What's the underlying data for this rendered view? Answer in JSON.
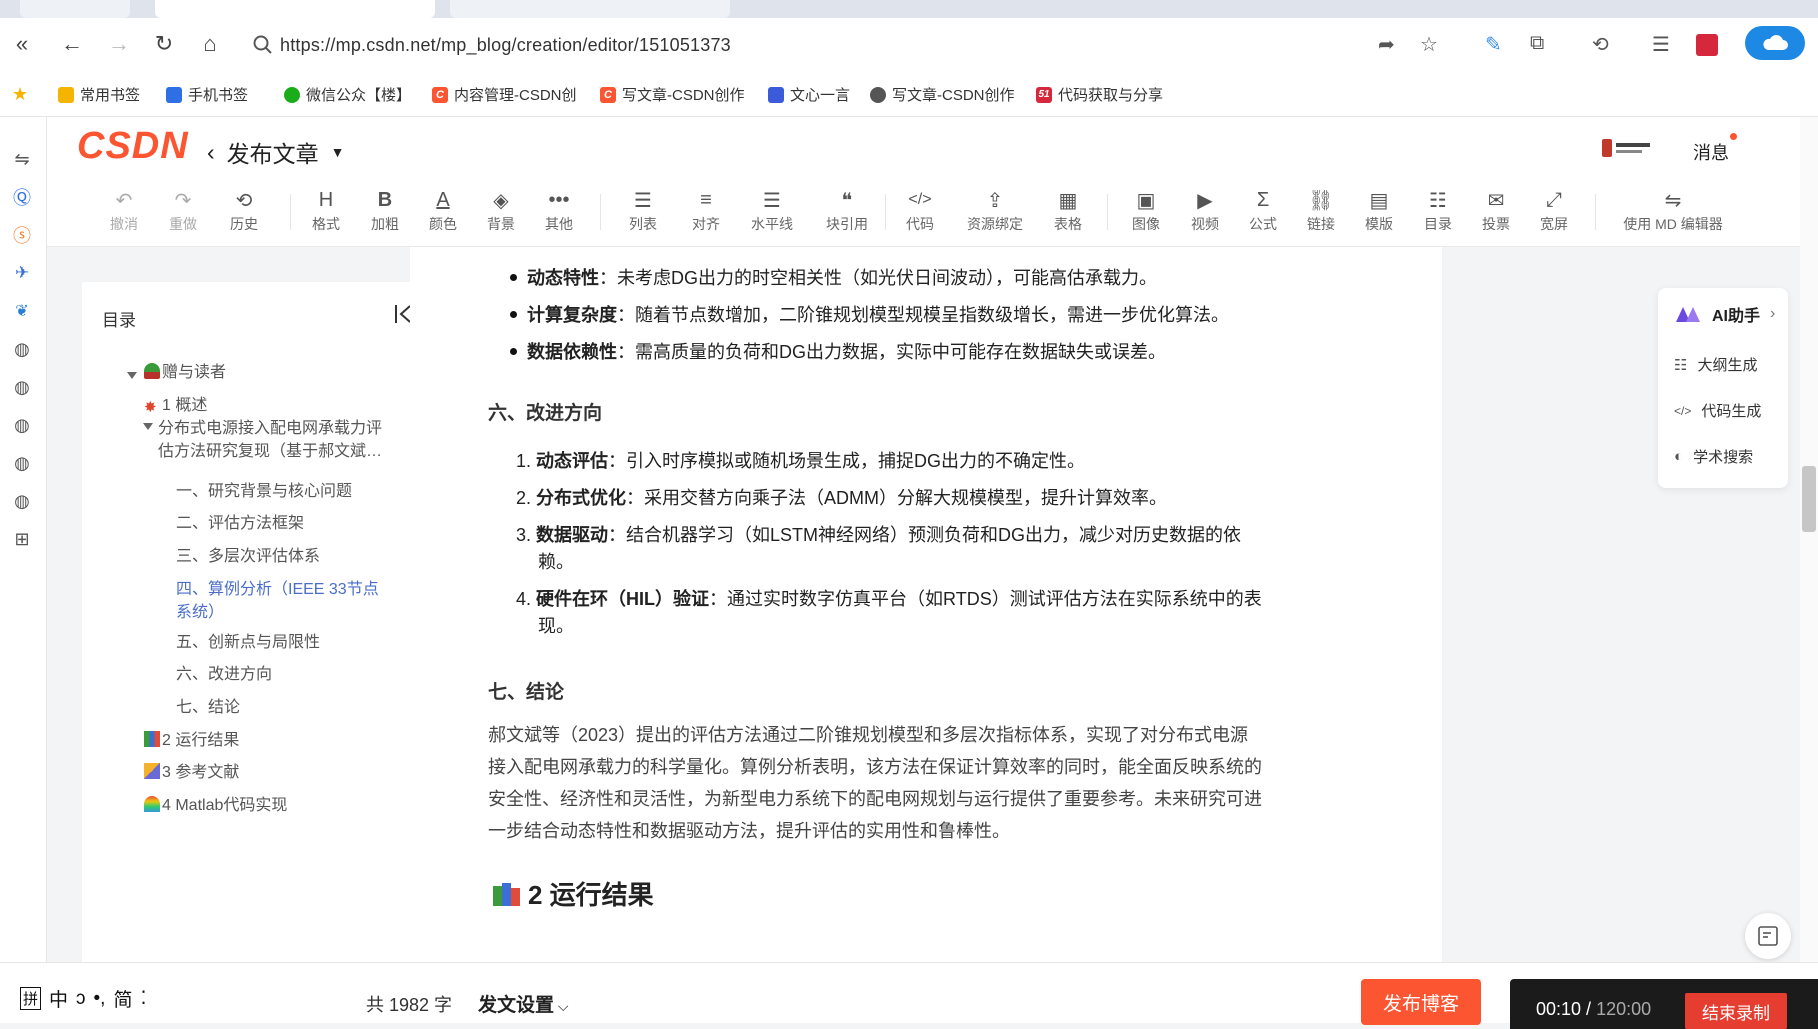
{
  "browser": {
    "url": "https://mp.csdn.net/mp_blog/creation/editor/151051373",
    "bookmarks": [
      {
        "label": "常用书签",
        "icon": "bookmark-icon",
        "color": "#f5b400"
      },
      {
        "label": "手机书签",
        "icon": "bookmark-icon",
        "color": "#2f6fe4"
      },
      {
        "label": "微信公众【楼】",
        "icon": "wechat-icon",
        "color": "#1aad19"
      },
      {
        "label": "内容管理-CSDN创",
        "icon": "csdn-icon",
        "color": "#fc5531"
      },
      {
        "label": "写文章-CSDN创作",
        "icon": "csdn-icon",
        "color": "#fc5531"
      },
      {
        "label": "文心一言",
        "icon": "wenxin-icon",
        "color": "#3b5bdb"
      },
      {
        "label": "写文章-CSDN创作",
        "icon": "globe-icon",
        "color": "#555555"
      },
      {
        "label": "代码获取与分享",
        "icon": "51-icon",
        "color": "#d6283c"
      }
    ]
  },
  "editor": {
    "logo": "CSDN",
    "title": "发布文章",
    "messages_label": "消息",
    "toolbar": [
      {
        "label": "撤消",
        "icon": "↶"
      },
      {
        "label": "重做",
        "icon": "↷"
      },
      {
        "label": "历史",
        "icon": "⟲"
      },
      {
        "label": "格式",
        "icon": "H"
      },
      {
        "label": "加粗",
        "icon": "B"
      },
      {
        "label": "颜色",
        "icon": "A"
      },
      {
        "label": "背景",
        "icon": "◈"
      },
      {
        "label": "其他",
        "icon": "•••"
      },
      {
        "label": "列表",
        "icon": "☰"
      },
      {
        "label": "对齐",
        "icon": "≡"
      },
      {
        "label": "水平线",
        "icon": "☰"
      },
      {
        "label": "块引用",
        "icon": "❝"
      },
      {
        "label": "代码",
        "icon": "</>"
      },
      {
        "label": "资源绑定",
        "icon": "⇪"
      },
      {
        "label": "表格",
        "icon": "▦"
      },
      {
        "label": "图像",
        "icon": "▣"
      },
      {
        "label": "视频",
        "icon": "▶"
      },
      {
        "label": "公式",
        "icon": "Σ"
      },
      {
        "label": "链接",
        "icon": "⛓"
      },
      {
        "label": "模版",
        "icon": "▤"
      },
      {
        "label": "目录",
        "icon": "☷"
      },
      {
        "label": "投票",
        "icon": "✉"
      },
      {
        "label": "宽屏",
        "icon": "⤢"
      },
      {
        "label": "使用 MD 编辑器",
        "icon": "⇋"
      }
    ]
  },
  "toc": {
    "title": "目录",
    "items": [
      {
        "text": "赠与读者",
        "emoji": "🎍"
      },
      {
        "text": "1 概述",
        "emoji": "💥"
      },
      {
        "text": "分布式电源接入配电网承载力评"
      },
      {
        "text": "估方法研究复现（基于郝文斌…"
      },
      {
        "text": "一、研究背景与核心问题"
      },
      {
        "text": "二、评估方法框架"
      },
      {
        "text": "三、多层次评估体系"
      },
      {
        "text": "四、算例分析（IEEE 33节点"
      },
      {
        "text": "系统）"
      },
      {
        "text": "五、创新点与局限性"
      },
      {
        "text": "六、改进方向"
      },
      {
        "text": "七、结论"
      },
      {
        "text": "2 运行结果",
        "emoji": "📚"
      },
      {
        "text": "3 参考文献",
        "emoji": "🎉"
      },
      {
        "text": "4 Matlab代码实现",
        "emoji": "🌈"
      }
    ]
  },
  "content": {
    "bullets": [
      {
        "bold": "动态特性",
        "text": "：未考虑DG出力的时空相关性（如光伏日间波动），可能高估承载力。"
      },
      {
        "bold": "计算复杂度",
        "text": "：随着节点数增加，二阶锥规划模型规模呈指数级增长，需进一步优化算法。"
      },
      {
        "bold": "数据依赖性",
        "text": "：需高质量的负荷和DG出力数据，实际中可能存在数据缺失或误差。"
      }
    ],
    "section6_title": "六、改进方向",
    "improvements": [
      {
        "num": "1.",
        "bold": "动态评估",
        "text": "：引入时序模拟或随机场景生成，捕捉DG出力的不确定性。"
      },
      {
        "num": "2.",
        "bold": "分布式优化",
        "text": "：采用交替方向乘子法（ADMM）分解大规模模型，提升计算效率。"
      },
      {
        "num": "3.",
        "bold": "数据驱动",
        "text": "：结合机器学习（如LSTM神经网络）预测负荷和DG出力，减少对历史数据的依",
        "cont": "赖。"
      },
      {
        "num": "4.",
        "bold": "硬件在环（HIL）验证",
        "text": "：通过实时数字仿真平台（如RTDS）测试评估方法在实际系统中的表",
        "cont": "现。"
      }
    ],
    "section7_title": "七、结论",
    "conclusion": [
      "郝文斌等（2023）提出的评估方法通过二阶锥规划模型和多层次指标体系，实现了对分布式电源",
      "接入配电网承载力的科学量化。算例分析表明，该方法在保证计算效率的同时，能全面反映系统的",
      "安全性、经济性和灵活性，为新型电力系统下的配电网规划与运行提供了重要参考。未来研究可进",
      "一步结合动态特性和数据驱动方法，提升评估的实用性和鲁棒性。"
    ],
    "h2": "2 运行结果"
  },
  "ai_panel": {
    "title": "AI助手",
    "items": [
      {
        "label": "大纲生成",
        "icon": "outline-icon"
      },
      {
        "label": "代码生成",
        "icon": "code-icon"
      },
      {
        "label": "学术搜索",
        "icon": "academic-search-icon"
      }
    ]
  },
  "footer": {
    "ime": [
      "拼",
      "中",
      "ↄ",
      "•,",
      "简",
      "⁚"
    ],
    "word_count": "共 1982 字",
    "settings": "发文设置",
    "publish": "发布博客",
    "rec_time": "00:10",
    "rec_total": "120:00",
    "rec_end": "结束录制"
  },
  "colors": {
    "brand": "#fc5531",
    "active_link": "#4a6ec9",
    "record_red": "#e53d30"
  }
}
